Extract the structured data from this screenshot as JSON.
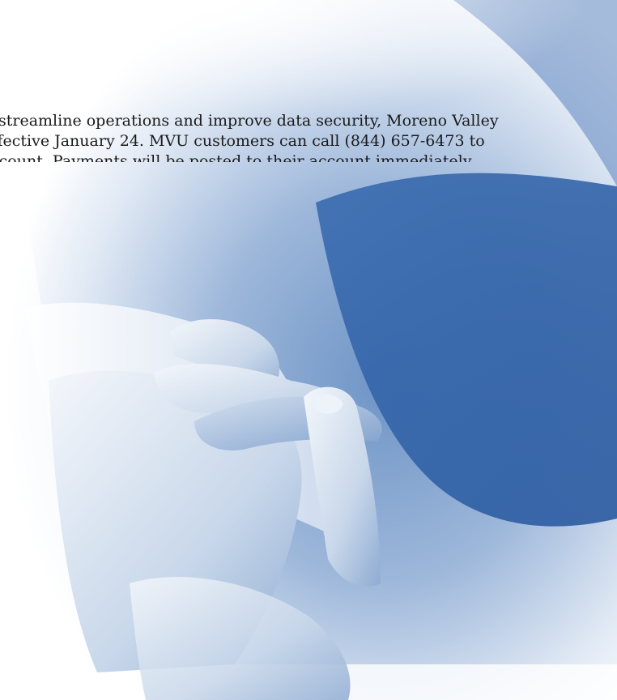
{
  "notice": {
    "lines": [
      "streamline operations and improve data security, Moreno Valley",
      "ffective January 24. MVU customers can call (844) 657-6473 to",
      "ccount. Payments will be posted to their account immediately."
    ]
  },
  "colors": {
    "accent_blue": "#2f63a8",
    "light_blue": "#c9d8ec",
    "background": "#ffffff",
    "text": "#1a1a1a"
  }
}
